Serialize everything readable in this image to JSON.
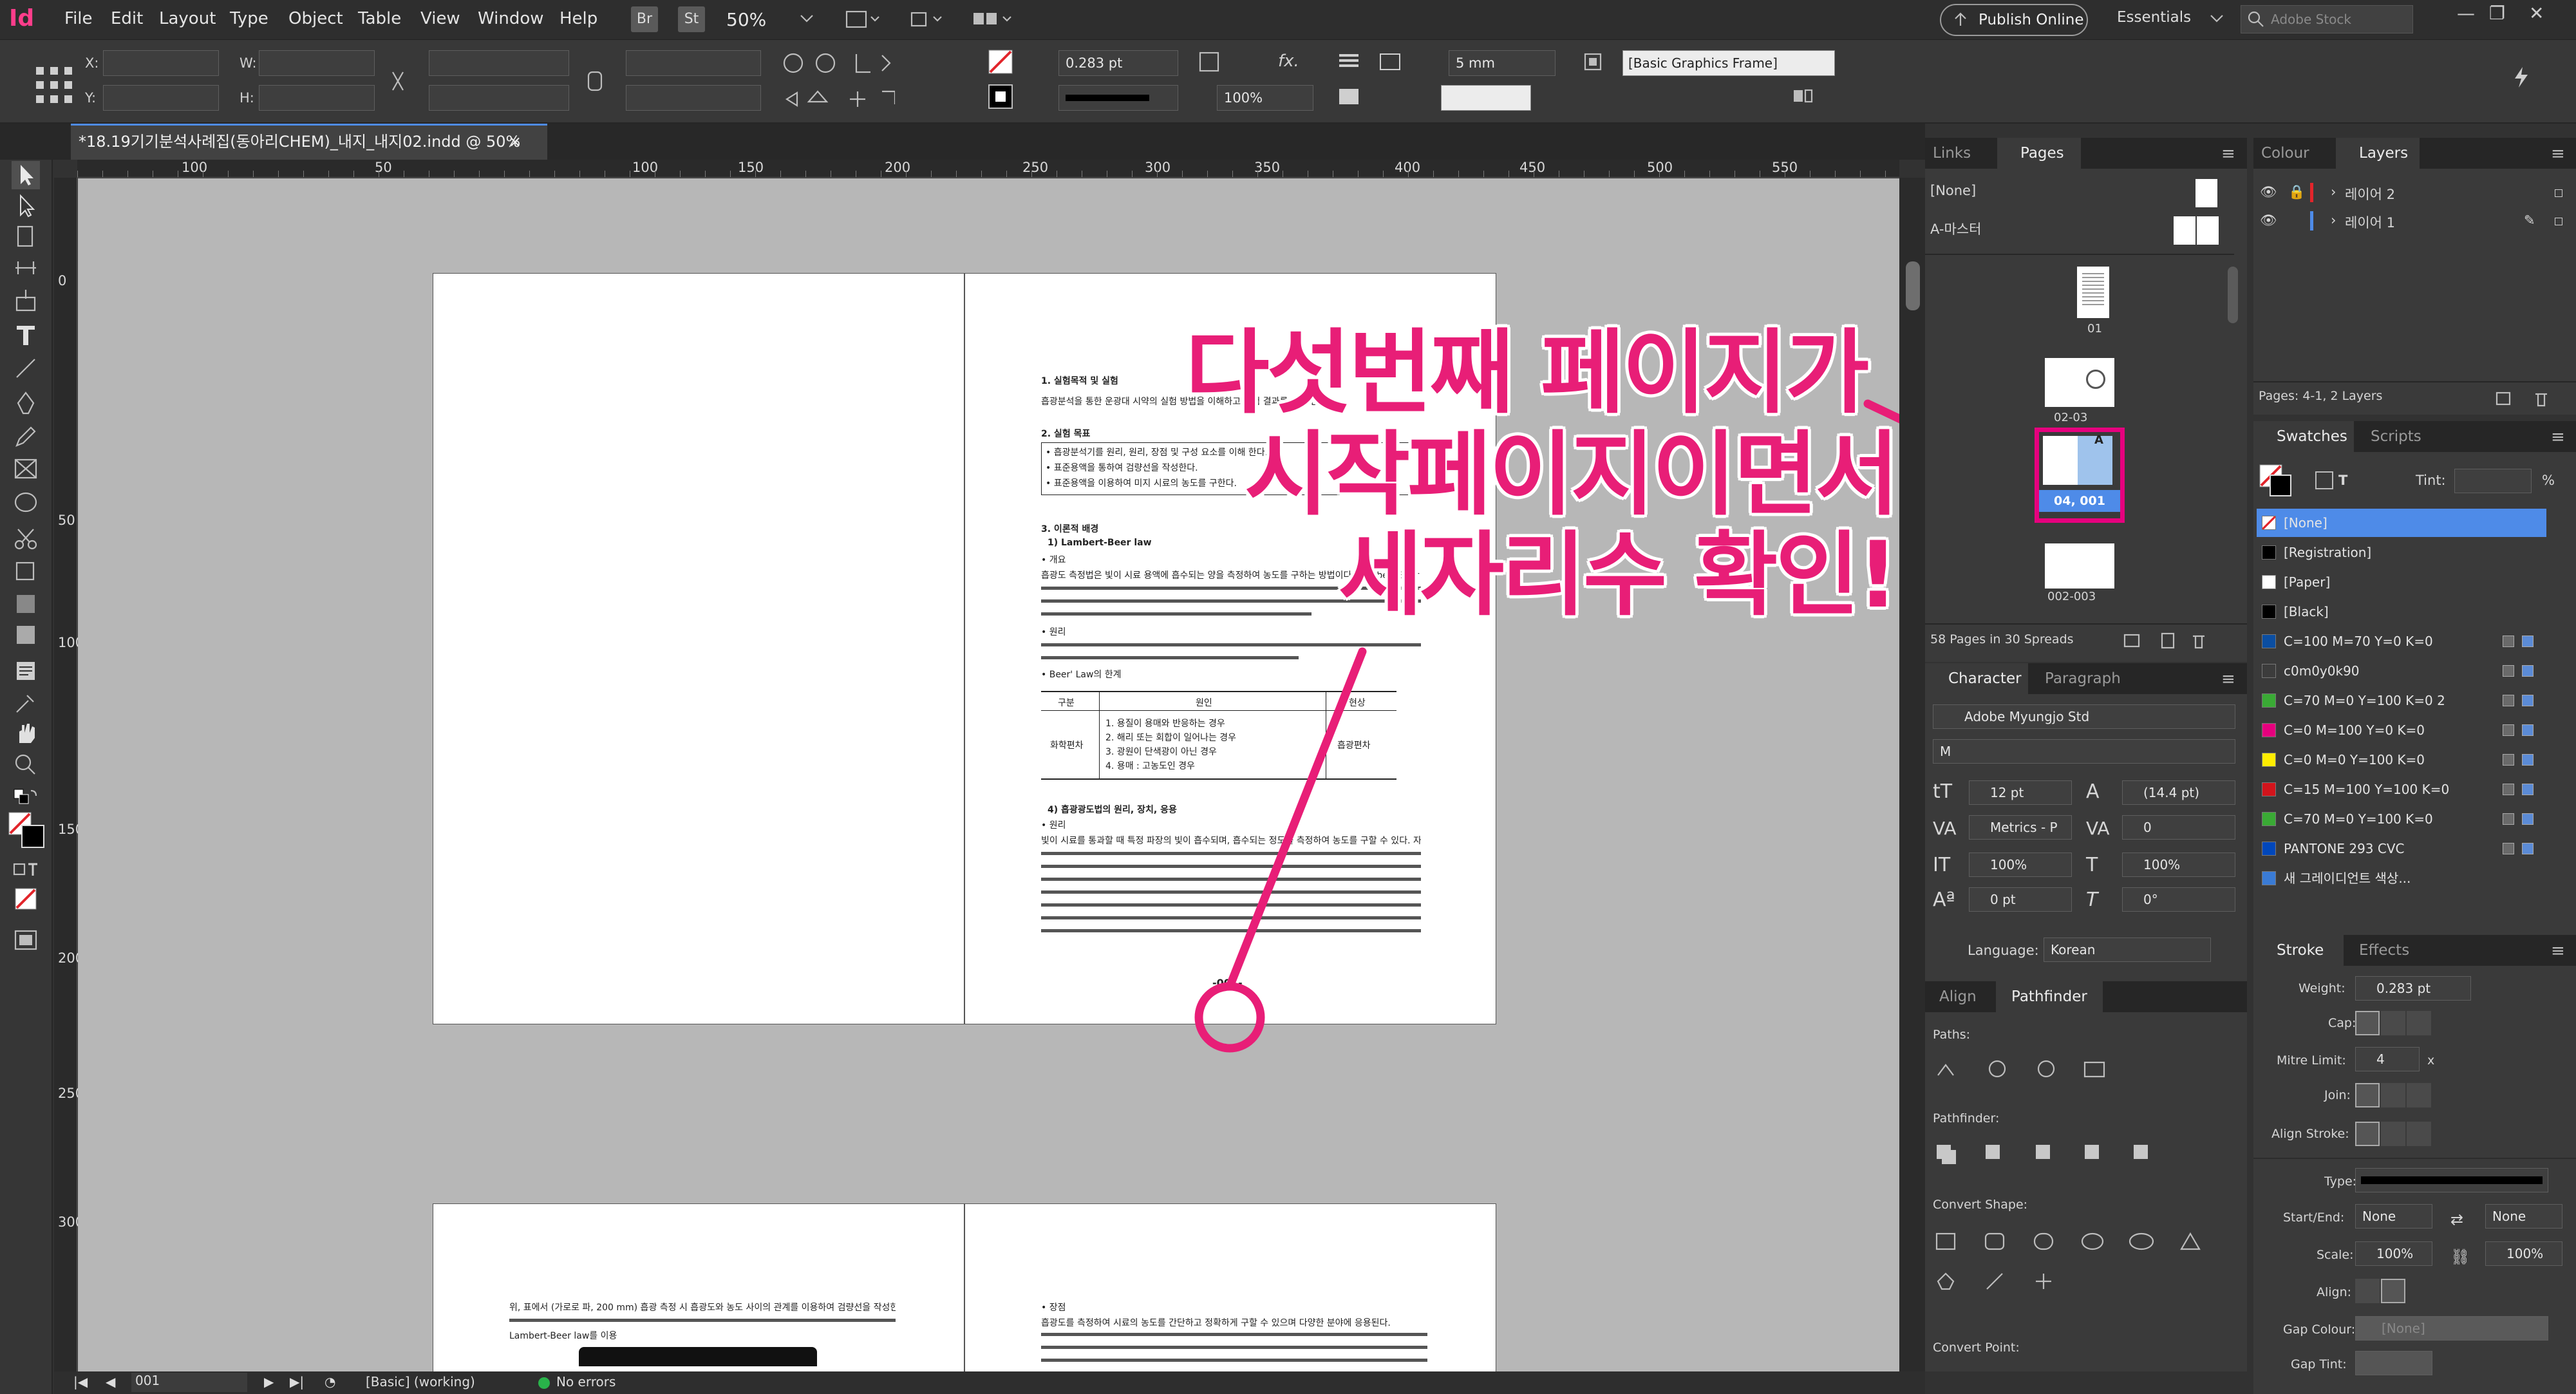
{
  "app": {
    "logo": "Id"
  },
  "menu": [
    "File",
    "Edit",
    "Layout",
    "Type",
    "Object",
    "Table",
    "View",
    "Window",
    "Help"
  ],
  "menubar": {
    "bridge": "Br",
    "stock": "St",
    "zoom": "50%",
    "publish": "Publish Online",
    "workspace": "Essentials",
    "search_placeholder": "Adobe Stock"
  },
  "control": {
    "x_label": "X:",
    "y_label": "Y:",
    "w_label": "W:",
    "h_label": "H:",
    "stroke_weight": "0.283 pt",
    "scale": "100%",
    "fx": "fx.",
    "gap": "5 mm",
    "object_style": "[Basic Graphics Frame]"
  },
  "document": {
    "tab_title": "*18.19기기분석사례집(동아리CHEM)_내지_내지02.indd @ 50%",
    "close": "×"
  },
  "ruler": {
    "h": [
      "100",
      "50",
      "100",
      "150",
      "200",
      "250",
      "300",
      "350",
      "400",
      "450",
      "500",
      "550"
    ],
    "v": [
      "0",
      "50",
      "100",
      "150",
      "200",
      "250",
      "300"
    ]
  },
  "annotation": {
    "line1": "다섯번째 페이지가",
    "line2": "시작페이지이면서",
    "line3": "세자리수 확인!"
  },
  "page_content": {
    "h1": "1. 실험목적 및 실험",
    "p1": "흡광분석을 통한 운광대 시약의 실험 방법을 이해하고 실험 결과를 분석 한다.",
    "h2": "2. 실험 목표",
    "bullets": [
      "• 흡광분석기를 원리, 원리, 장점 및 구성 요소를 이해 한다.",
      "• 표준용액을 통하여 검량선을 작성한다.",
      "• 표준용액을 이용하여 미지 시료의 농도를 구한다."
    ],
    "h3": "3. 이론적 배경",
    "h3a": "1) Lambert-Beer law",
    "b1": "• 개요",
    "para": "흡광도 측정법은 빛이 시료 용액에 흡수되는 양을 측정하여 농도를 구하는 방법이다. Lambert-Beer 법칙은 흡광도가 농도와 셀 길이에 비례한다는 법칙이다.",
    "b2": "• 원리",
    "b3": "• Beer' Law의 한계",
    "table_head": [
      "구분",
      "원인",
      "현상"
    ],
    "table_cell": "화학편차",
    "table_cell2": "흡광편차",
    "table_rows": [
      "1. 용질이 용매와 반응하는 경우",
      "2. 해리 또는 회합이 일어나는 경우",
      "3. 광원이 단색광이 아닌 경우",
      "4. 용매 : 고농도인 경우"
    ],
    "h4": "4) 흡광광도법의 원리, 장치, 응용",
    "b4": "• 원리",
    "para2": "빛이 시료를 통과할 때 특정 파장의 빛이 흡수되며, 흡수되는 정도를 측정하여 농도를 구할 수 있다. 자외선 및 가시광선 영역(200~800 nm)을 이용한다.",
    "folio": "-001-",
    "p2_text": "위, 표에서 (가로로 파, 200 mm) 흡광 측정 시 흡광도와 농도 사이의 관계를 이용하여 검량선을 작성한다.",
    "p2_sub": "Lambert-Beer law를 이용",
    "p3_text": "• 장점",
    "p3_para": "흡광도를 측정하여 시료의 농도를 간단하고 정확하게 구할 수 있으며 다양한 분야에 응용된다."
  },
  "status": {
    "page": "001",
    "style": "[Basic] (working)",
    "errors": "No errors"
  },
  "pages_panel": {
    "tabs": [
      "Links",
      "Pages"
    ],
    "none": "[None]",
    "master": "A-마스터",
    "labels": [
      "01",
      "02-03",
      "04, 001",
      "002-003"
    ],
    "marker": "A",
    "footer": "58 Pages in 30 Spreads"
  },
  "layers_panel": {
    "tabs": [
      "Colour",
      "Layers"
    ],
    "layers": [
      "레이어 2",
      "레이어 1"
    ],
    "footer": "Pages: 4-1, 2 Layers"
  },
  "swatches_panel": {
    "tabs": [
      "Swatches",
      "Scripts"
    ],
    "tint_label": "Tint:",
    "tint_pct": "%",
    "items": [
      {
        "name": "[None]",
        "color": "none"
      },
      {
        "name": "[Registration]",
        "color": "#000000"
      },
      {
        "name": "[Paper]",
        "color": "#ffffff"
      },
      {
        "name": "[Black]",
        "color": "#000000"
      },
      {
        "name": "C=100 M=70 Y=0 K=0",
        "color": "#0b4ea2"
      },
      {
        "name": "c0m0y0k90",
        "color": "#3c3c3c"
      },
      {
        "name": "C=70 M=0 Y=100 K=0 2",
        "color": "#3aaa35"
      },
      {
        "name": "C=0 M=100 Y=0 K=0",
        "color": "#e6007e"
      },
      {
        "name": "C=0 M=0 Y=100 K=0",
        "color": "#ffed00"
      },
      {
        "name": "C=15 M=100 Y=100 K=0",
        "color": "#d3141c"
      },
      {
        "name": "C=70 M=0 Y=100 K=0",
        "color": "#3aaa35"
      },
      {
        "name": "PANTONE 293 CVC",
        "color": "#0047bb"
      },
      {
        "name": "새 그레이디언트 색상...",
        "color": "#3a7bd5"
      }
    ]
  },
  "character_panel": {
    "tabs": [
      "Character",
      "Paragraph"
    ],
    "font": "Adobe Myungjo Std",
    "style": "M",
    "size": "12 pt",
    "leading": "(14.4 pt)",
    "kerning": "Metrics - P",
    "tracking": "0",
    "vscale": "100%",
    "hscale": "100%",
    "baseline": "0 pt",
    "skew": "0°",
    "language_label": "Language:",
    "language": "Korean"
  },
  "pathfinder_panel": {
    "tabs": [
      "Align",
      "Pathfinder"
    ],
    "paths": "Paths:",
    "pathfinder": "Pathfinder:",
    "convert_shape": "Convert Shape:",
    "convert_point": "Convert Point:"
  },
  "stroke_panel": {
    "tabs": [
      "Stroke",
      "Effects"
    ],
    "weight_label": "Weight:",
    "weight": "0.283 pt",
    "cap_label": "Cap:",
    "mitre_label": "Mitre Limit:",
    "mitre": "4",
    "mitre_x": "x",
    "join_label": "Join:",
    "align_label": "Align Stroke:",
    "type_label": "Type:",
    "startend_label": "Start/End:",
    "start": "None",
    "end": "None",
    "scale_label": "Scale:",
    "scale1": "100%",
    "scale2": "100%",
    "align2_label": "Align:",
    "gapcolour_label": "Gap Colour:",
    "gapcolour": "[None]",
    "gaptint_label": "Gap Tint:"
  },
  "colors": {
    "accent": "#e81e77",
    "selection": "#4e8be8",
    "pink_frame": "#e6007e"
  }
}
